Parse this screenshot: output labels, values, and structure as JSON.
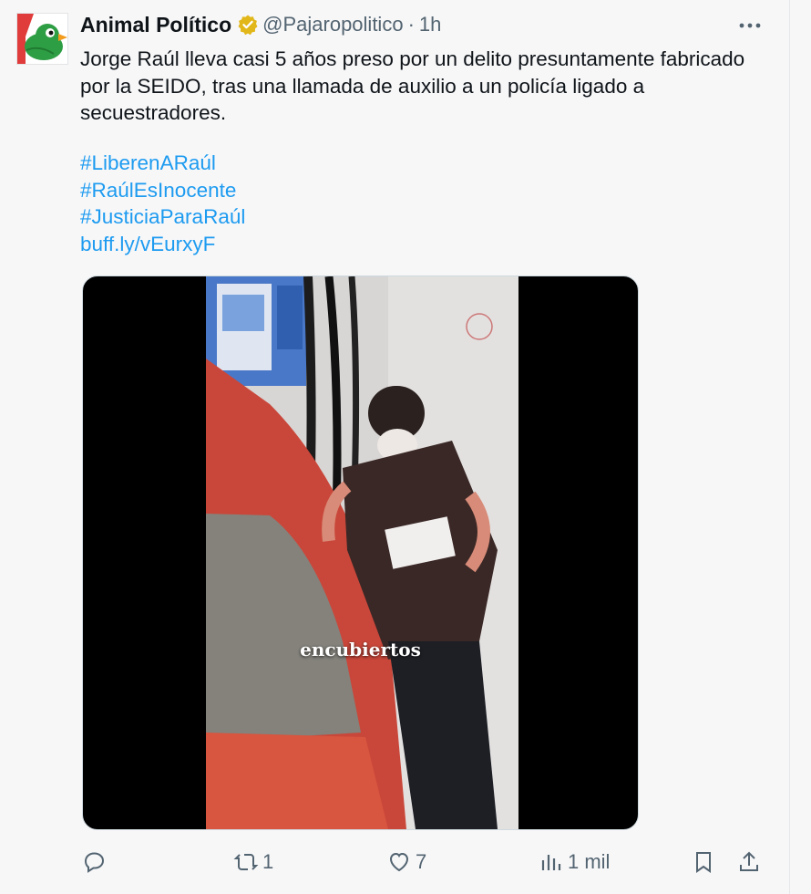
{
  "tweet": {
    "display_name": "Animal Político",
    "handle": "@Pajaropolitico",
    "separator": "·",
    "time": "1h",
    "text": "Jorge Raúl lleva casi 5 años preso por un delito presuntamente fabricado por la SEIDO, tras una llamada de auxilio a un policía ligado a secuestradores.",
    "links": [
      "#LiberenARaúl",
      "#RaúlEsInocente",
      "#JusticiaParaRaúl",
      "buff.ly/vEurxyF"
    ]
  },
  "media": {
    "caption": "encubiertos"
  },
  "actions": {
    "reply_icon": "reply-icon",
    "retweet_count": "1",
    "like_count": "7",
    "views_count": "1 mil",
    "bookmark_icon": "bookmark-icon",
    "share_icon": "share-icon"
  },
  "colors": {
    "link": "#1d9bf0",
    "verified_badge": "#e2b719",
    "muted": "#536471",
    "background": "#f7f7f8"
  }
}
